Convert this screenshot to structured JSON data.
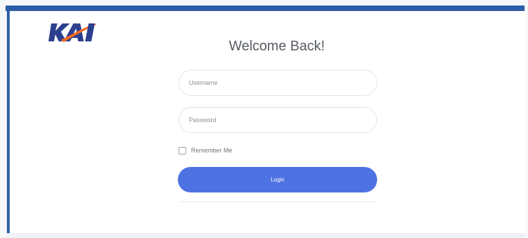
{
  "brand": {
    "logo_text": "KAI",
    "primary_color": "#2d5fa8",
    "accent_color": "#f26a21"
  },
  "login": {
    "title": "Welcome Back!",
    "username_placeholder": "Username",
    "password_placeholder": "Password",
    "remember_label": "Remember Me",
    "remember_checked": false,
    "login_label": "Login",
    "button_color": "#4f72e3"
  }
}
